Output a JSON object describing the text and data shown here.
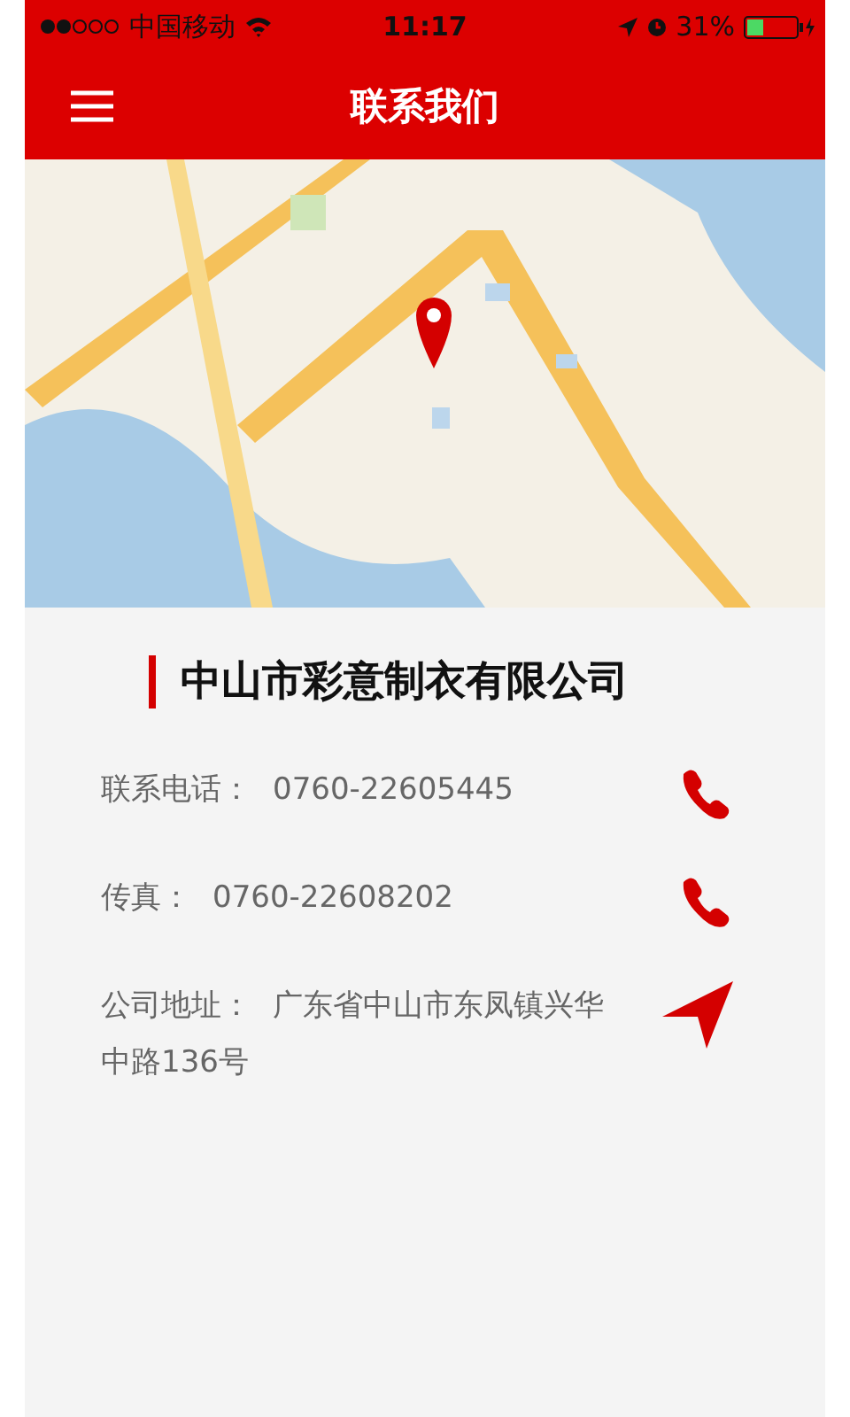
{
  "status_bar": {
    "carrier": "中国移动",
    "time": "11:17",
    "battery": "31%"
  },
  "header": {
    "title": "联系我们"
  },
  "company": {
    "name": "中山市彩意制衣有限公司"
  },
  "contacts": [
    {
      "kind": "phone",
      "label": "联系电话：",
      "value": "0760-22605445"
    },
    {
      "kind": "phone",
      "label": "传真：",
      "value": "0760-22608202"
    },
    {
      "kind": "navigate",
      "label": "公司地址：",
      "value": "广东省中山市东凤镇兴华中路136号"
    }
  ]
}
